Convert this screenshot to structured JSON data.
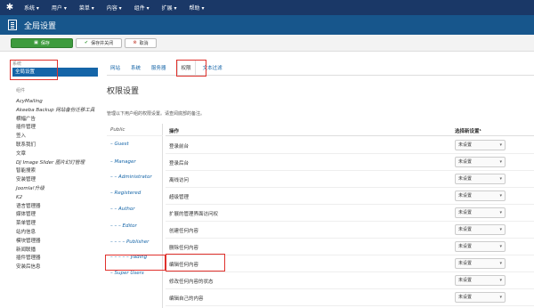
{
  "navbar": {
    "logo": "joomla-logo-icon",
    "menu": [
      "系统 ▾",
      "用户 ▾",
      "菜单 ▾",
      "内容 ▾",
      "组件 ▾",
      "扩展 ▾",
      "帮助 ▾"
    ]
  },
  "title": {
    "icon": "list-icon",
    "text": "全局设置"
  },
  "toolbar": {
    "save_label": "保存",
    "save_close_label": "保存并关闭",
    "cancel_label": "取消",
    "save_icon": "save-icon",
    "save_close_icon": "check-icon",
    "cancel_icon": "cancel-icon"
  },
  "sidebar": {
    "group_label": "系统",
    "active_item": "全局设置",
    "components_title": "组件",
    "items": [
      {
        "label": "AcyMailing",
        "italic": true
      },
      {
        "label": "Akeeba Backup 网站备份迁移工具",
        "italic": true
      },
      {
        "label": "横幅广告",
        "italic": false
      },
      {
        "label": "插件管理",
        "italic": false
      },
      {
        "label": "签入",
        "italic": false
      },
      {
        "label": "联系我们",
        "italic": false
      },
      {
        "label": "文章",
        "italic": false
      },
      {
        "label": "DJ Image Slider 图片幻灯管理",
        "italic": true
      },
      {
        "label": "智能搜索",
        "italic": false
      },
      {
        "label": "安装管理",
        "italic": false
      },
      {
        "label": "Joomla!升级",
        "italic": true
      },
      {
        "label": "K2",
        "italic": true
      },
      {
        "label": "语言管理器",
        "italic": false
      },
      {
        "label": "媒体管理",
        "italic": false
      },
      {
        "label": "菜单管理",
        "italic": false
      },
      {
        "label": "站内信息",
        "italic": false
      },
      {
        "label": "模块管理器",
        "italic": false
      },
      {
        "label": "新闻联播",
        "italic": false
      },
      {
        "label": "插件管理器",
        "italic": false
      },
      {
        "label": "安装后信息",
        "italic": false
      }
    ]
  },
  "tabs": [
    {
      "label": "网站",
      "active": false
    },
    {
      "label": "系统",
      "active": false
    },
    {
      "label": "服务器",
      "active": false
    },
    {
      "label": "权限",
      "active": true
    },
    {
      "label": "文本过滤",
      "active": false
    }
  ],
  "permissions": {
    "title": "权限设置",
    "description": "管理以下用户组的权限设置。请查阅底部的备注。",
    "groups": [
      "Public",
      "– Guest",
      "– Manager",
      "– – Administrator",
      "– Registered",
      "– – Author",
      "– – – Editor",
      "– – – – Publisher",
      "– – – – – yading",
      "– Super Users"
    ],
    "col_action": "操作",
    "col_setting": "选择新设置¹",
    "rows": [
      {
        "action": "登录前台",
        "value": "未设置"
      },
      {
        "action": "登录后台",
        "value": "未设置"
      },
      {
        "action": "离线访问",
        "value": "未设置"
      },
      {
        "action": "超级管理",
        "value": "未设置"
      },
      {
        "action": "扩展的管理界面访问权",
        "value": "未设置"
      },
      {
        "action": "创建任何内容",
        "value": "未设置"
      },
      {
        "action": "删除任何内容",
        "value": "未设置"
      },
      {
        "action": "编辑任何内容",
        "value": "未设置"
      },
      {
        "action": "修改任何内容的状态",
        "value": "未设置"
      },
      {
        "action": "编辑自己的内容",
        "value": "未设置"
      }
    ]
  },
  "colors": {
    "navbar": "#1a3867",
    "titlebar": "#17568c",
    "accent": "#1565a8",
    "save_button": "#3e9b3e",
    "highlight": "#e0312c"
  }
}
